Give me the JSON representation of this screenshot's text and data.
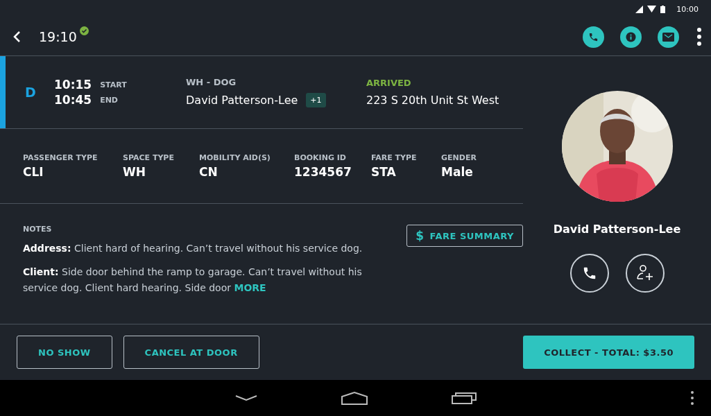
{
  "status_bar": {
    "time": "10:00"
  },
  "app_bar": {
    "time": "19:10",
    "confirmed": true
  },
  "trip": {
    "type": "D",
    "start_time": "10:15",
    "start_label": "START",
    "end_time": "10:45",
    "end_label": "END",
    "tags": "WH - DOG",
    "passenger": "David Patterson-Lee",
    "extra_count": "+1",
    "status": "ARRIVED",
    "arrived": true,
    "address": "223 S 20th Unit  St West"
  },
  "details": [
    {
      "label": "PASSENGER TYPE",
      "value": "CLI"
    },
    {
      "label": "SPACE TYPE",
      "value": "WH"
    },
    {
      "label": "MOBILITY AID(S)",
      "value": "CN"
    },
    {
      "label": "BOOKING ID",
      "value": "1234567"
    },
    {
      "label": "FARE TYPE",
      "value": "STA"
    },
    {
      "label": "GENDER",
      "value": "Male"
    }
  ],
  "notes": {
    "title": "NOTES",
    "fare_button": {
      "icon": "$",
      "label": "FARE SUMMARY"
    },
    "items": [
      {
        "text": "**Address:** Client hard of hearing. Can’t travel without his service dog."
      },
      {
        "text": "**Client:** Side door behind the ramp to garage. Can’t travel without his service dog. Client hard hearing. Side door",
        "more": "MORE"
      }
    ]
  },
  "profile": {
    "name": "David Patterson-Lee"
  },
  "actions": [
    {
      "label": "NO SHOW",
      "kind": "outline"
    },
    {
      "label": "CANCEL AT DOOR",
      "kind": "outline"
    },
    {
      "label": "COLLECT - TOTAL: $3.50",
      "kind": "primary"
    }
  ]
}
